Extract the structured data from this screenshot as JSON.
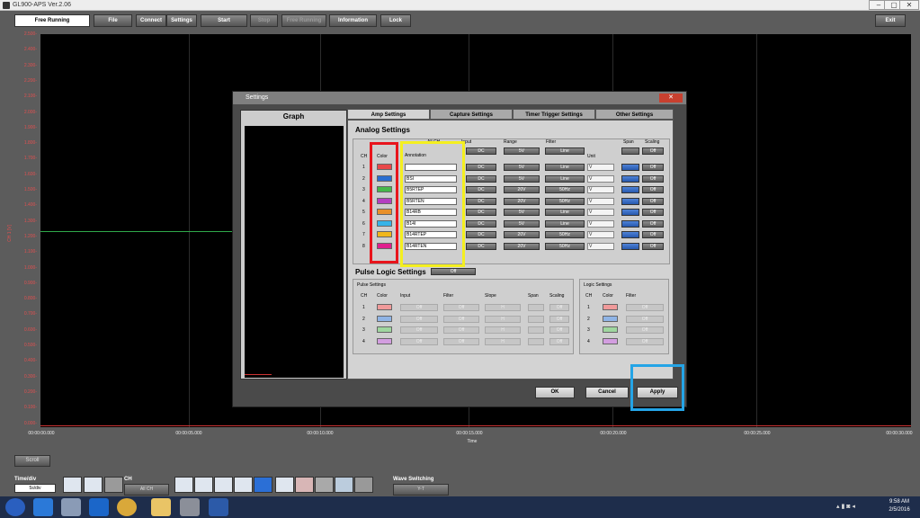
{
  "window": {
    "title": "GL900-APS Ver.2.06",
    "min": "–",
    "max": "▢",
    "close": "✕"
  },
  "toolbar": {
    "mode_value": "Free Running",
    "file": "File",
    "connect": "Connect",
    "settings": "Settings",
    "start": "Start",
    "stop": "Stop",
    "free_running": "Free Running",
    "information": "Information",
    "lock": "Lock",
    "exit": "Exit"
  },
  "plot": {
    "y_ticks": [
      "2.500-",
      "2.400-",
      "2.300-",
      "2.200-",
      "2.100-",
      "2.000-",
      "1.900-",
      "1.800-",
      "1.700-",
      "1.600-",
      "1.500-",
      "1.400-",
      "1.300-",
      "1.200-",
      "1.100-",
      "1.000-",
      "0.900-",
      "0.800-",
      "0.700-",
      "0.600-",
      "0.500-",
      "0.400-",
      "0.300-",
      "0.200-",
      "0.100-",
      "0.000-"
    ],
    "x_ticks": [
      "00:00:00.000",
      "00:00:05.000",
      "00:00:10.000",
      "00:00:15.000",
      "00:00:20.000",
      "00:00:25.000",
      "00:00:30.000"
    ],
    "xlabel": "Time",
    "side_label": "CH 1  [V]"
  },
  "bottom": {
    "scroll": "Scroll",
    "timediv_label": "Time/div",
    "timediv_value": "5s/div",
    "ch_label": "CH",
    "ch_value": "All CH",
    "wave_label": "Wave Switching",
    "wave_value": "Y-T"
  },
  "dialog": {
    "title": "Settings",
    "close": "✕",
    "graph_title": "Graph",
    "tabs": [
      "Amp Settings",
      "Capture Settings",
      "Timer Trigger Settings",
      "Other Settings"
    ],
    "analog_title": "Analog Settings",
    "cols": {
      "ch": "CH",
      "color": "Color",
      "allch": "All CH",
      "annotation": "Annotation",
      "input": "Input",
      "range": "Range",
      "filter": "Filter",
      "unit": "Unit",
      "span": "Span",
      "scaling": "Scaling"
    },
    "analog_rows": [
      {
        "ch": "1",
        "color": "#e8484a",
        "annotation": "",
        "input": "DC",
        "range": "5V",
        "filter": "Line",
        "unit": "V",
        "scaling": "Off"
      },
      {
        "ch": "2",
        "color": "#2a6ed0",
        "annotation": "BSI",
        "input": "DC",
        "range": "5V",
        "filter": "Line",
        "unit": "V",
        "scaling": "Off"
      },
      {
        "ch": "3",
        "color": "#45b84a",
        "annotation": "B5RTEP",
        "input": "DC",
        "range": "20V",
        "filter": "50Hz",
        "unit": "V",
        "scaling": "Off"
      },
      {
        "ch": "4",
        "color": "#b43fc1",
        "annotation": "B5RTEN",
        "input": "DC",
        "range": "20V",
        "filter": "50Hz",
        "unit": "V",
        "scaling": "Off"
      },
      {
        "ch": "5",
        "color": "#e8902a",
        "annotation": "B14RB",
        "input": "DC",
        "range": "5V",
        "filter": "Line",
        "unit": "V",
        "scaling": "Off"
      },
      {
        "ch": "6",
        "color": "#37b4e8",
        "annotation": "B14I",
        "input": "DC",
        "range": "5V",
        "filter": "Line",
        "unit": "V",
        "scaling": "Off"
      },
      {
        "ch": "7",
        "color": "#f0b71c",
        "annotation": "B14RTEP",
        "input": "DC",
        "range": "20V",
        "filter": "50Hz",
        "unit": "V",
        "scaling": "Off"
      },
      {
        "ch": "8",
        "color": "#e01f8e",
        "annotation": "B14RTEN",
        "input": "DC",
        "range": "20V",
        "filter": "50Hz",
        "unit": "V",
        "scaling": "Off"
      }
    ],
    "pulse_title": "Pulse Logic Settings",
    "pulse_value": "Off",
    "pulse_sub": "Pulse Settings",
    "logic_sub": "Logic Settings",
    "pulse_cols": {
      "ch": "CH",
      "color": "Color",
      "input": "Input",
      "filter": "Filter",
      "slope": "Slope",
      "span": "Span",
      "scaling": "Scaling"
    },
    "pulse_rows": [
      {
        "ch": "1",
        "color": "#f09a9a",
        "input": "Off",
        "filter": "Off",
        "slope": "H",
        "scaling": "Off"
      },
      {
        "ch": "2",
        "color": "#8fb4e6",
        "input": "Off",
        "filter": "Off",
        "slope": "H",
        "scaling": "Off"
      },
      {
        "ch": "3",
        "color": "#9fd69f",
        "input": "Off",
        "filter": "Off",
        "slope": "H",
        "scaling": "Off"
      },
      {
        "ch": "4",
        "color": "#d39ee0",
        "input": "Off",
        "filter": "Off",
        "slope": "H",
        "scaling": "Off"
      }
    ],
    "logic_cols": {
      "ch": "CH",
      "color": "Color",
      "filter": "Filter"
    },
    "logic_rows": [
      {
        "ch": "1",
        "color": "#f09a9a",
        "filter": "Off"
      },
      {
        "ch": "2",
        "color": "#8fb4e6",
        "filter": "Off"
      },
      {
        "ch": "3",
        "color": "#9fd69f",
        "filter": "Off"
      },
      {
        "ch": "4",
        "color": "#d39ee0",
        "filter": "Off"
      }
    ],
    "ok": "OK",
    "cancel": "Cancel",
    "apply": "Apply"
  },
  "taskbar": {
    "time": "9:58 AM",
    "date": "2/5/2016"
  },
  "colors": {
    "highlight_red": "#e8141c",
    "highlight_yellow": "#f4ef1f",
    "highlight_blue": "#24a4e6",
    "trace_green": "#2fa84a"
  }
}
